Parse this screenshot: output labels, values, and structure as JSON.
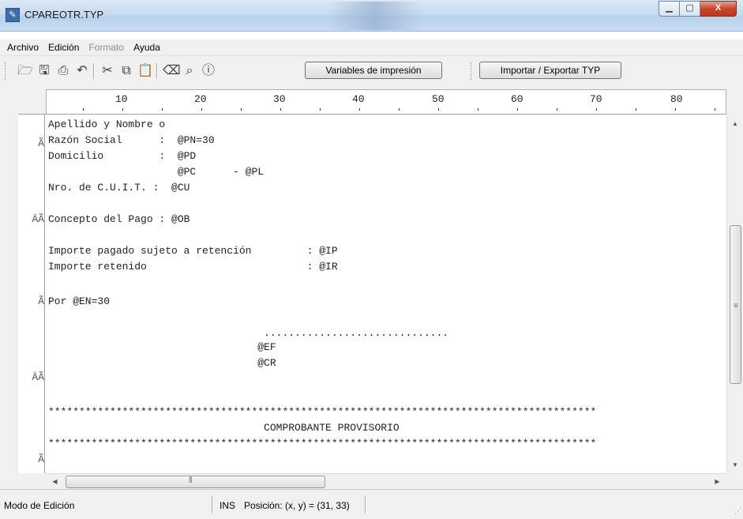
{
  "window": {
    "title": "CPAREOTR.TYP",
    "app_icon": "app-icon",
    "controls": {
      "minimize": "▭",
      "maximize": "□",
      "close": "X"
    }
  },
  "menu": {
    "items": [
      {
        "label": "Archivo",
        "enabled": true
      },
      {
        "label": "Edición",
        "enabled": true
      },
      {
        "label": "Formato",
        "enabled": false
      },
      {
        "label": "Ayuda",
        "enabled": true
      }
    ]
  },
  "toolbar": {
    "icons": [
      "open-icon",
      "save-icon",
      "print-icon",
      "undo-icon",
      "cut-icon",
      "copy-icon",
      "paste-icon",
      "erase-icon",
      "find-icon",
      "help-icon"
    ],
    "variables_button": "Variables de impresión",
    "import_export_button": "Importar / Exportar TYP"
  },
  "ruler": {
    "labels": [
      "10",
      "20",
      "30",
      "40",
      "50",
      "60",
      "70",
      "80"
    ]
  },
  "editor": {
    "gutter_marks": [
      "Ã",
      "ÄÃ",
      "Ã",
      "ÄÃ",
      "Ã"
    ],
    "lines": [
      "Apellido y Nombre o",
      "Razón Social      :  @PN=30",
      "Domicilio         :  @PD",
      "                     @PC      - @PL",
      "Nro. de C.U.I.T. :  @CU",
      "",
      "Concepto del Pago : @OB",
      "",
      "Importe pagado sujeto a retención         : @IP",
      "Importe retenido                          : @IR",
      "",
      "Por @EN=30",
      "",
      "",
      "                                   ..............................",
      "                                  @EF",
      "                                  @CR",
      "",
      "",
      "*****************************************************************************************",
      "                                   COMPROBANTE PROVISORIO",
      "*****************************************************************************************"
    ]
  },
  "statusbar": {
    "mode": "Modo de Edición",
    "ins": "INS",
    "position": "Posición: (x, y) = (31, 33)"
  }
}
